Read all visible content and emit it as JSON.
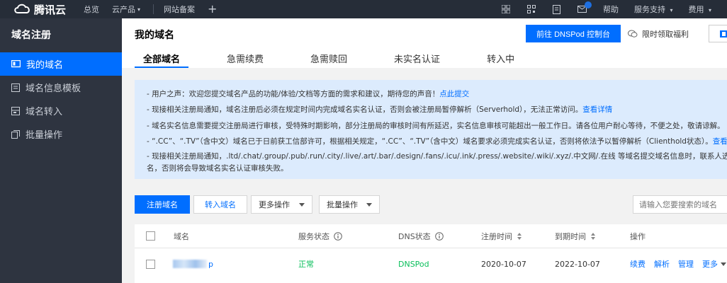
{
  "topbar": {
    "logo_text": "腾讯云",
    "nav": [
      "总览",
      "云产品",
      "网站备案"
    ],
    "right_links": [
      "帮助",
      "服务支持",
      "费用"
    ]
  },
  "sidebar": {
    "title": "域名注册",
    "items": [
      {
        "label": "我的域名",
        "icon": "monitor-icon",
        "active": true
      },
      {
        "label": "域名信息模板",
        "icon": "template-icon",
        "active": false
      },
      {
        "label": "域名转入",
        "icon": "transfer-icon",
        "active": false
      },
      {
        "label": "批量操作",
        "icon": "batch-icon",
        "active": false
      }
    ]
  },
  "header": {
    "title": "我的域名",
    "dnspod_button": "前往 DNSPod 控制台",
    "welfare_link": "限时领取福利"
  },
  "tabs": [
    "全部域名",
    "急需续费",
    "急需赎回",
    "未实名认证",
    "转入中"
  ],
  "notice": {
    "lines": [
      {
        "text": "- 用户之声：欢迎您提交域名产品的功能/体验/文档等方面的需求和建议，期待您的声音！",
        "link": "点此提交"
      },
      {
        "text": "- 现接相关注册局通知，域名注册后必须在规定时间内完成域名实名认证，否则会被注册局暂停解析（Serverhold），无法正常访问。",
        "link": "查看详情"
      },
      {
        "text": "- 域名实名信息需要提交注册局进行审核，受特殊时期影响，部分注册局的审核时间有所延迟，实名信息审核可能超出一般工作日。请各位用户耐心等待，不便之处，敬请谅解。",
        "link": ""
      },
      {
        "text": "- “.CC”、“.TV”（含中文）域名已于日前获工信部许可，根据相关规定，“.CC”、“.TV”（含中文）域名要求必须完成实名认证，否则将依法予以暂停解析（Clienthold状态）。",
        "link": "查看指引"
      },
      {
        "text": "- 现接相关注册局通知，.ltd/.chat/.group/.pub/.run/.city/.live/.art/.bar/.design/.fans/.icu/.ink/.press/.website/.wiki/.xyz/.中文网/.在线 等域名提交域名信息时，联系人选项需填写为个人",
        "link": ""
      },
      {
        "text": "名，否则将会导致域名实名认证审核失败。",
        "link": ""
      }
    ]
  },
  "toolbar": {
    "register_button": "注册域名",
    "transfer_button": "转入域名",
    "more_actions": "更多操作",
    "batch_actions": "批量操作",
    "search_placeholder": "请输入您要搜索的域名"
  },
  "table": {
    "headers": [
      "域名",
      "服务状态",
      "DNS状态",
      "注册时间",
      "到期时间",
      "操作"
    ],
    "rows": [
      {
        "domain_suffix": "p",
        "status": "正常",
        "dns_status": "DNSPod",
        "register_date": "2020-10-07",
        "expire_date": "2022-10-07",
        "actions": [
          "续费",
          "解析",
          "管理",
          "更多"
        ]
      }
    ]
  },
  "colors": {
    "primary": "#006eff",
    "topbar_bg": "#262d38",
    "sidebar_bg": "#2e3440",
    "notice_bg": "#dcebfd",
    "status_ok": "#0abf5b"
  }
}
